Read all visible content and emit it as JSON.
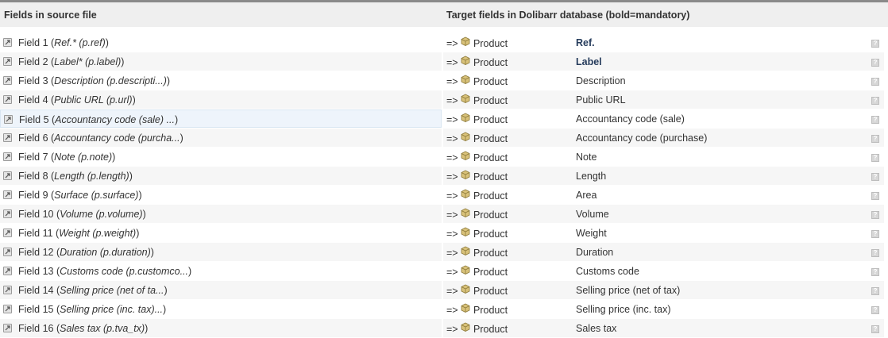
{
  "header": {
    "source_title": "Fields in source file",
    "target_title": "Target fields in Dolibarr database (bold=mandatory)"
  },
  "arrow_text": "=>",
  "help_text": "?",
  "rows": [
    {
      "field": "Field 1",
      "source": "Ref.* (p.ref)",
      "group": "Product",
      "target": "Ref.",
      "mandatory": true
    },
    {
      "field": "Field 2",
      "source": "Label* (p.label)",
      "group": "Product",
      "target": "Label",
      "mandatory": true
    },
    {
      "field": "Field 3",
      "source": "Description (p.descripti...)",
      "group": "Product",
      "target": "Description",
      "mandatory": false
    },
    {
      "field": "Field 4",
      "source": "Public URL (p.url)",
      "group": "Product",
      "target": "Public URL",
      "mandatory": false
    },
    {
      "field": "Field 5",
      "source": "Accountancy code (sale) ...",
      "group": "Product",
      "target": "Accountancy code (sale)",
      "mandatory": false
    },
    {
      "field": "Field 6",
      "source": "Accountancy code (purcha...",
      "group": "Product",
      "target": "Accountancy code (purchase)",
      "mandatory": false
    },
    {
      "field": "Field 7",
      "source": "Note (p.note)",
      "group": "Product",
      "target": "Note",
      "mandatory": false
    },
    {
      "field": "Field 8",
      "source": "Length (p.length)",
      "group": "Product",
      "target": "Length",
      "mandatory": false
    },
    {
      "field": "Field 9",
      "source": "Surface (p.surface)",
      "group": "Product",
      "target": "Area",
      "mandatory": false
    },
    {
      "field": "Field 10",
      "source": "Volume (p.volume)",
      "group": "Product",
      "target": "Volume",
      "mandatory": false
    },
    {
      "field": "Field 11",
      "source": "Weight (p.weight)",
      "group": "Product",
      "target": "Weight",
      "mandatory": false
    },
    {
      "field": "Field 12",
      "source": "Duration (p.duration)",
      "group": "Product",
      "target": "Duration",
      "mandatory": false
    },
    {
      "field": "Field 13",
      "source": "Customs code (p.customco...",
      "group": "Product",
      "target": "Customs code",
      "mandatory": false
    },
    {
      "field": "Field 14",
      "source": "Selling price (net of ta...",
      "group": "Product",
      "target": "Selling price (net of tax)",
      "mandatory": false
    },
    {
      "field": "Field 15",
      "source": "Selling price (inc. tax)...",
      "group": "Product",
      "target": "Selling price (inc. tax)",
      "mandatory": false
    },
    {
      "field": "Field 16",
      "source": "Sales tax (p.tva_tx)",
      "group": "Product",
      "target": "Sales tax",
      "mandatory": false
    }
  ]
}
